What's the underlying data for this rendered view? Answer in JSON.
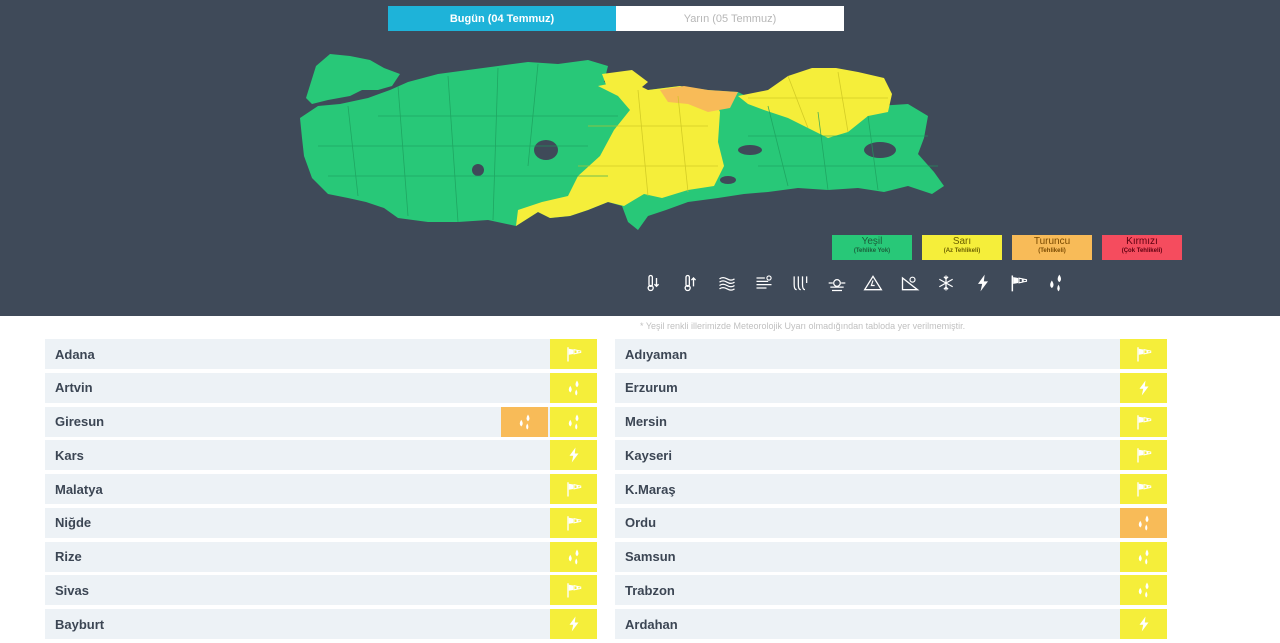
{
  "tabs": [
    {
      "label": "Bugün (04 Temmuz)",
      "active": true
    },
    {
      "label": "Yarın (05 Temmuz)",
      "active": false
    }
  ],
  "legend": [
    {
      "name": "Yeşil",
      "desc": "(Tehlike Yok)",
      "color": "#28c878",
      "text_color": "#1b5e3a"
    },
    {
      "name": "Sarı",
      "desc": "(Az Tehlikeli)",
      "color": "#f5ee3a",
      "text_color": "#6b5f00"
    },
    {
      "name": "Turuncu",
      "desc": "(Tehlikeli)",
      "color": "#f8bb58",
      "text_color": "#7a4a00"
    },
    {
      "name": "Kırmızı",
      "desc": "(Çok Tehlikeli)",
      "color": "#f54c5e",
      "text_color": "#5e0010"
    }
  ],
  "hazard_icons": [
    "low-temperature-icon",
    "high-temperature-icon",
    "fog-icon",
    "dust-icon",
    "hot-wind-icon",
    "storm-icon",
    "avalanche-icon",
    "landslide-icon",
    "snow-icon",
    "lightning-icon",
    "wind-flag-icon",
    "rain-icon"
  ],
  "colors": {
    "background": "#3f4a59",
    "map_green": "#28c878",
    "map_yellow": "#f5ee3a",
    "map_orange": "#f8bb58",
    "map_lake": "#3f4a59",
    "active_tab": "#1eb3d9"
  },
  "note": "* Yeşil renkli illerimizde Meteorolojik Uyarı olmadığından tabloda yer verilmemiştir.",
  "left_column": [
    {
      "province": "Adana",
      "badges": [
        {
          "level": "yellow",
          "icon": "wind-flag-icon"
        }
      ]
    },
    {
      "province": "Artvin",
      "badges": [
        {
          "level": "yellow",
          "icon": "rain-icon"
        }
      ]
    },
    {
      "province": "Giresun",
      "badges": [
        {
          "level": "orange",
          "icon": "rain-icon"
        },
        {
          "level": "yellow",
          "icon": "rain-icon"
        }
      ]
    },
    {
      "province": "Kars",
      "badges": [
        {
          "level": "yellow",
          "icon": "lightning-icon"
        }
      ]
    },
    {
      "province": "Malatya",
      "badges": [
        {
          "level": "yellow",
          "icon": "wind-flag-icon"
        }
      ]
    },
    {
      "province": "Niğde",
      "badges": [
        {
          "level": "yellow",
          "icon": "wind-flag-icon"
        }
      ]
    },
    {
      "province": "Rize",
      "badges": [
        {
          "level": "yellow",
          "icon": "rain-icon"
        }
      ]
    },
    {
      "province": "Sivas",
      "badges": [
        {
          "level": "yellow",
          "icon": "wind-flag-icon"
        }
      ]
    },
    {
      "province": "Bayburt",
      "badges": [
        {
          "level": "yellow",
          "icon": "lightning-icon"
        }
      ]
    }
  ],
  "right_column": [
    {
      "province": "Adıyaman",
      "badges": [
        {
          "level": "yellow",
          "icon": "wind-flag-icon"
        }
      ]
    },
    {
      "province": "Erzurum",
      "badges": [
        {
          "level": "yellow",
          "icon": "lightning-icon"
        }
      ]
    },
    {
      "province": "Mersin",
      "badges": [
        {
          "level": "yellow",
          "icon": "wind-flag-icon"
        }
      ]
    },
    {
      "province": "Kayseri",
      "badges": [
        {
          "level": "yellow",
          "icon": "wind-flag-icon"
        }
      ]
    },
    {
      "province": "K.Maraş",
      "badges": [
        {
          "level": "yellow",
          "icon": "wind-flag-icon"
        }
      ]
    },
    {
      "province": "Ordu",
      "badges": [
        {
          "level": "orange",
          "icon": "rain-icon"
        }
      ]
    },
    {
      "province": "Samsun",
      "badges": [
        {
          "level": "yellow",
          "icon": "rain-icon"
        }
      ]
    },
    {
      "province": "Trabzon",
      "badges": [
        {
          "level": "yellow",
          "icon": "rain-icon"
        }
      ]
    },
    {
      "province": "Ardahan",
      "badges": [
        {
          "level": "yellow",
          "icon": "lightning-icon"
        }
      ]
    }
  ]
}
